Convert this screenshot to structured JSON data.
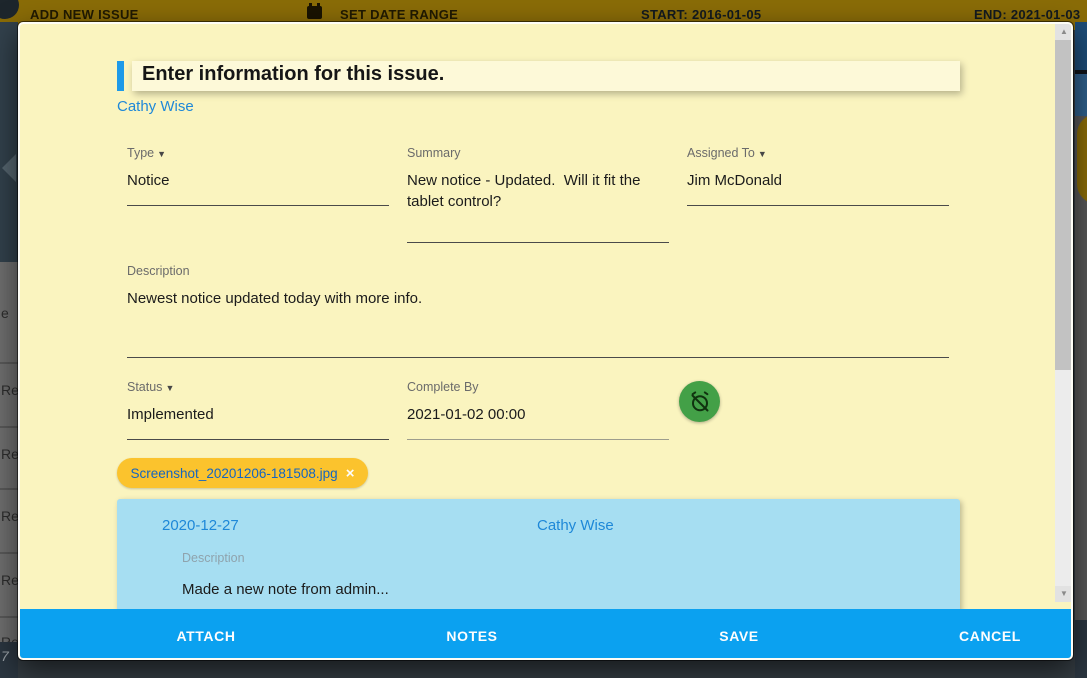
{
  "background": {
    "top_bar": {
      "add_new_issue": "ADD NEW ISSUE",
      "set_date_range": "SET DATE RANGE",
      "start": "START: 2016-01-05",
      "end": "END: 2021-01-03"
    },
    "left_table": {
      "partial_cell_e": "e",
      "rows": [
        "Re",
        "Re",
        "Re",
        "Re",
        "Re"
      ],
      "page_number": "7"
    }
  },
  "dialog": {
    "title": "Enter information for this issue.",
    "author": "Cathy Wise",
    "fields": {
      "type": {
        "label": "Type",
        "value": "Notice"
      },
      "summary": {
        "label": "Summary",
        "value": "New notice - Updated.  Will it fit the tablet control?"
      },
      "assigned_to": {
        "label": "Assigned To",
        "value": "Jim McDonald"
      },
      "description": {
        "label": "Description",
        "value": "Newest notice updated today with more info."
      },
      "status": {
        "label": "Status",
        "value": "Implemented"
      },
      "complete_by": {
        "label": "Complete By",
        "value": "2021-01-02 00:00"
      }
    },
    "attachment": {
      "filename": "Screenshot_20201206-181508.jpg",
      "remove_glyph": "×"
    },
    "note": {
      "date": "2020-12-27",
      "author": "Cathy Wise",
      "description_label": "Description",
      "text": "Made a new note from admin..."
    },
    "actions": {
      "attach": "ATTACH",
      "notes": "NOTES",
      "save": "SAVE",
      "cancel": "CANCEL"
    }
  },
  "icons": {
    "dropdown_arrow": "▼",
    "scroll_up": "▲",
    "scroll_down": "▼"
  },
  "colors": {
    "dialog_bg": "#FAF4BF",
    "header_accent_blue": "#1E9AE8",
    "link_blue": "#1E88D8",
    "action_bar_blue": "#0BA1F0",
    "note_card_blue": "#A6DEF2",
    "attachment_chip_amber": "#FBC32D",
    "attachment_text_blue": "#1565C0",
    "alarm_fab_green": "#43A047"
  }
}
